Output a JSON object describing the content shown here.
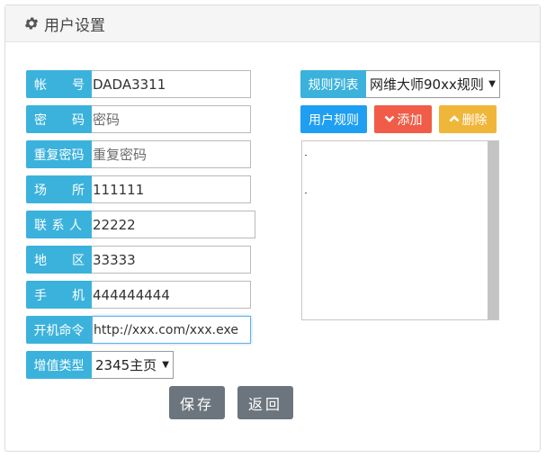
{
  "header": {
    "title": "用户设置",
    "icon": "gear-icon"
  },
  "form": {
    "account": {
      "label_chars": [
        "帐",
        "号"
      ],
      "value": "DADA3311"
    },
    "password": {
      "label_chars": [
        "密",
        "码"
      ],
      "placeholder": "密码"
    },
    "repeat": {
      "label": "重复密码",
      "placeholder": "重复密码"
    },
    "venue": {
      "label_chars": [
        "场",
        "所"
      ],
      "value": "111111"
    },
    "contact": {
      "label_chars": [
        "联",
        "系",
        "人"
      ],
      "value": "22222"
    },
    "region": {
      "label_chars": [
        "地",
        "区"
      ],
      "value": "33333"
    },
    "phone": {
      "label_chars": [
        "手",
        "机"
      ],
      "value": "444444444"
    },
    "boot": {
      "label": "开机命令",
      "value": "http://xxx.com/xxx.exe"
    },
    "addon": {
      "label": "增值类型",
      "selected": "2345主页"
    }
  },
  "rules": {
    "label": "规则列表",
    "selected": "网维大师90xx规则",
    "user_rules_label": "用户规则",
    "add_label": "添加",
    "delete_label": "删除"
  },
  "actions": {
    "save_label": "保存",
    "back_label": "返回"
  },
  "colors": {
    "label_bg": "#3bb2dc",
    "user_rules": "#1e9ff2",
    "add": "#f05c48",
    "delete": "#f0b63a",
    "action_btn": "#6c757d"
  }
}
